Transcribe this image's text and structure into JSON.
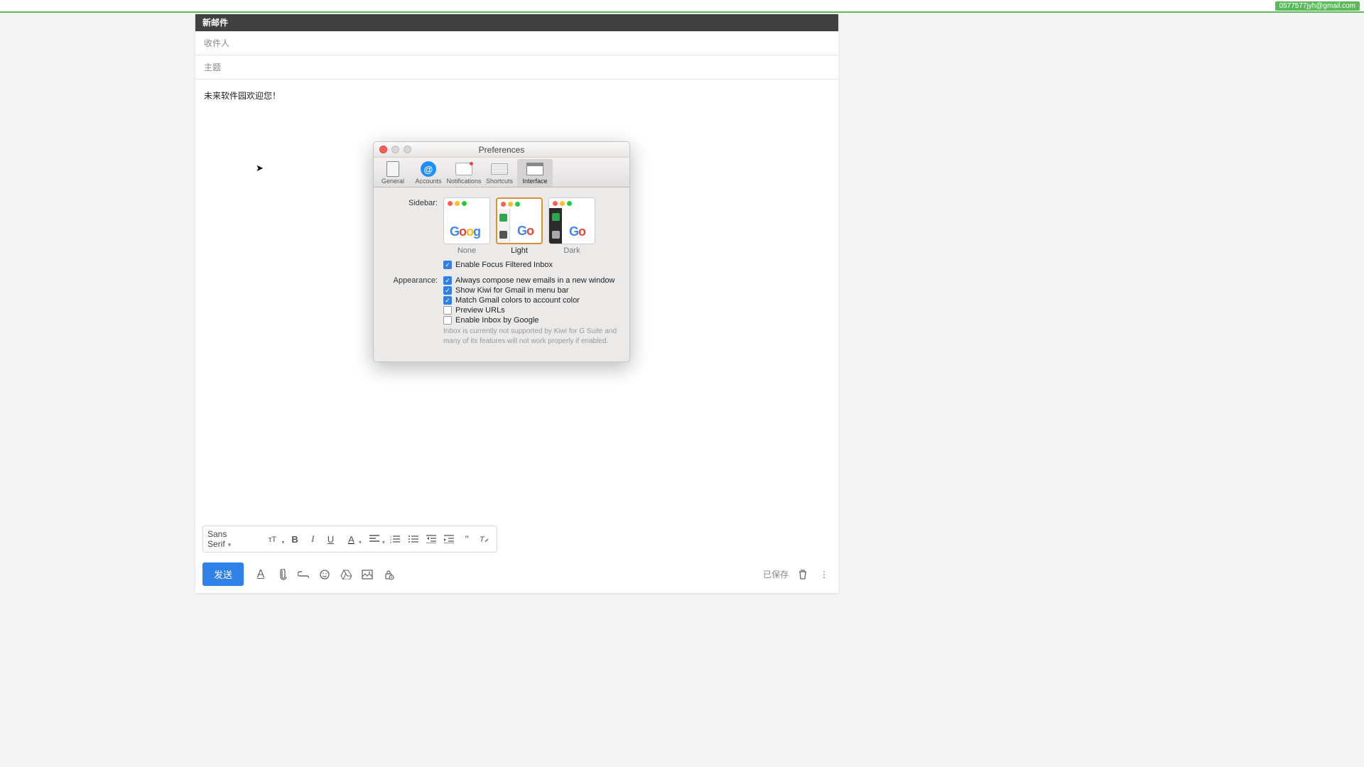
{
  "top_bar": {
    "account_email": "0577577jyh@gmail.com"
  },
  "compose": {
    "title": "新邮件",
    "to_label": "收件人",
    "subject_label": "主题",
    "body_text": "未来软件园欢迎您！"
  },
  "format_bar": {
    "font_name": "Sans Serif"
  },
  "bottom_bar": {
    "send_label": "发送",
    "saved_label": "已保存"
  },
  "prefs": {
    "window_title": "Preferences",
    "tabs": {
      "general": "General",
      "accounts": "Accounts",
      "notifications": "Notifications",
      "shortcuts": "Shortcuts",
      "interface": "Interface"
    },
    "labels": {
      "sidebar": "Sidebar:",
      "appearance": "Appearance:"
    },
    "sidebar_options": {
      "none": "None",
      "light": "Light",
      "dark": "Dark"
    },
    "checkboxes": {
      "enable_focus": "Enable Focus Filtered Inbox",
      "always_compose": "Always compose new emails in a new window",
      "show_menubar": "Show Kiwi for Gmail in menu bar",
      "match_colors": "Match Gmail colors to account color",
      "preview_urls": "Preview URLs",
      "enable_inbox": "Enable Inbox by Google"
    },
    "inbox_hint": "Inbox is currently not supported by Kiwi for G Suite and many of its features will not work properly if enabled."
  }
}
